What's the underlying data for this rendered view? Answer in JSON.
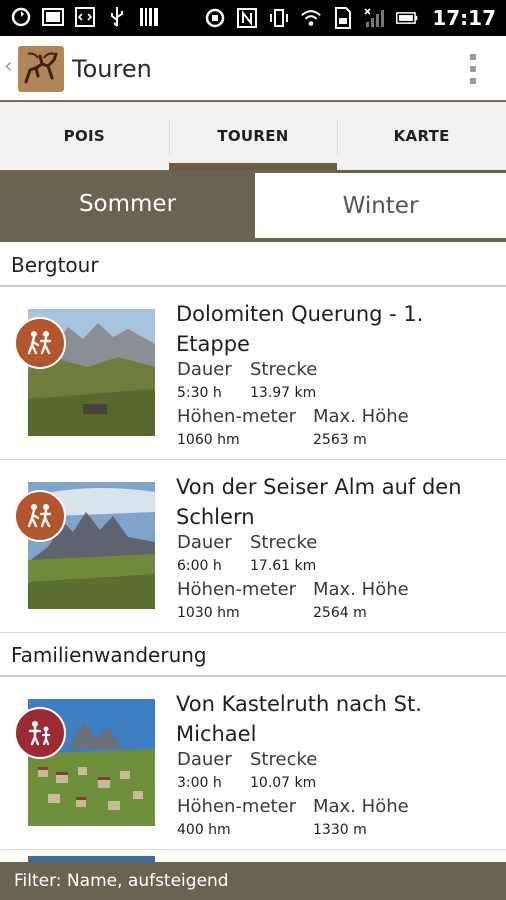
{
  "status_bar": {
    "time": "17:17"
  },
  "action_bar": {
    "title": "Touren"
  },
  "tabs": [
    {
      "label": "POIS"
    },
    {
      "label": "TOUREN"
    },
    {
      "label": "KARTE"
    }
  ],
  "segment": {
    "sommer": "Sommer",
    "winter": "Winter"
  },
  "sections": [
    {
      "title": "Bergtour",
      "tours": [
        {
          "title": "Dolomiten Querung - 1. Etappe",
          "dauer_label": "Dauer",
          "dauer": "5:30 h",
          "strecke_label": "Strecke",
          "strecke": "13.97 km",
          "hoehenmeter_label": "Höhen-meter",
          "hoehenmeter": "1060 hm",
          "maxhoehe_label": "Max. Höhe",
          "maxhoehe": "2563 m"
        },
        {
          "title": "Von der Seiser Alm auf den Schlern",
          "dauer_label": "Dauer",
          "dauer": "6:00 h",
          "strecke_label": "Strecke",
          "strecke": "17.61 km",
          "hoehenmeter_label": "Höhen-meter",
          "hoehenmeter": "1030 hm",
          "maxhoehe_label": "Max. Höhe",
          "maxhoehe": "2564 m"
        }
      ]
    },
    {
      "title": "Familienwanderung",
      "tours": [
        {
          "title": "Von Kastelruth nach St. Michael",
          "dauer_label": "Dauer",
          "dauer": "3:00 h",
          "strecke_label": "Strecke",
          "strecke": "10.07 km",
          "hoehenmeter_label": "Höhen-meter",
          "hoehenmeter": "400 hm",
          "maxhoehe_label": "Max. Höhe",
          "maxhoehe": "1330 m"
        }
      ]
    }
  ],
  "footer": {
    "filter_text": "Filter: Name, aufsteigend"
  },
  "colors": {
    "brand_brown": "#6b6351",
    "tab_indicator": "#6f5b3f",
    "badge_bergtour": "#b3552d",
    "badge_familie": "#9c2a35"
  },
  "icons": {
    "bergtour_badge": "hikers-icon",
    "familie_badge": "family-icon",
    "logo": "ibex-logo-icon"
  }
}
